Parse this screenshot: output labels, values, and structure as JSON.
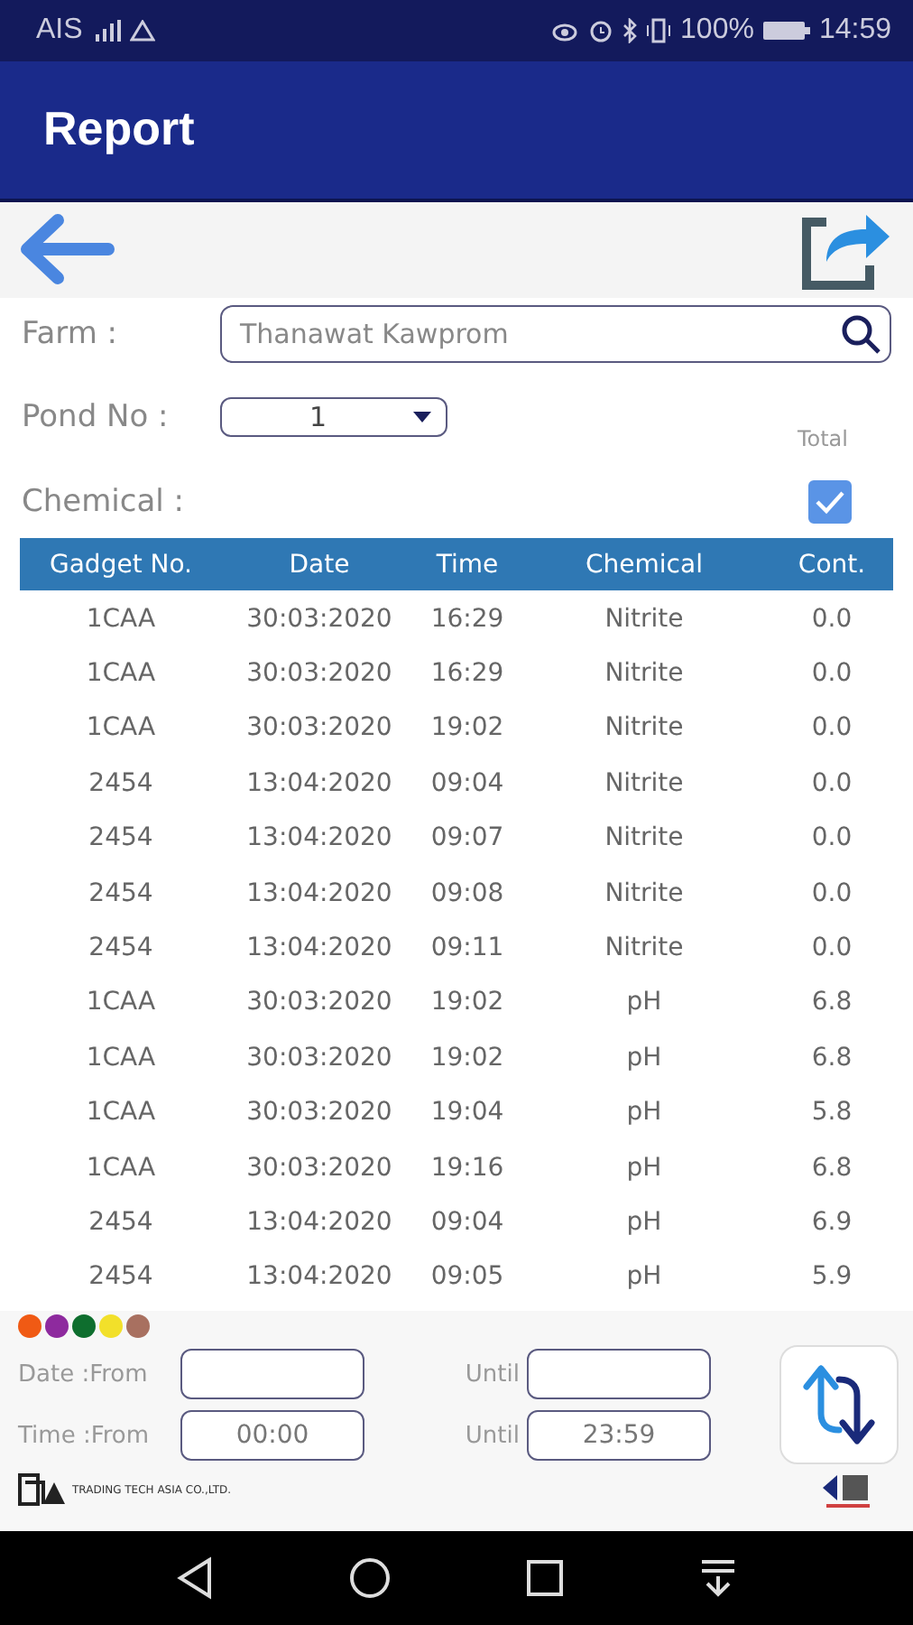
{
  "status_bar": {
    "carrier": "AIS",
    "battery": "100%",
    "time": "14:59"
  },
  "app_bar": {
    "title": "Report"
  },
  "form": {
    "farm_label": "Farm :",
    "farm_value": "Thanawat Kawprom",
    "pond_label": "Pond No :",
    "pond_value": "1",
    "total_label": "Total",
    "total_checked": true,
    "chemical_label": "Chemical :"
  },
  "table": {
    "columns": [
      "Gadget No.",
      "Date",
      "Time",
      "Chemical",
      "Cont."
    ],
    "rows": [
      [
        "1CAA",
        "30:03:2020",
        "16:29",
        "Nitrite",
        "0.0"
      ],
      [
        "1CAA",
        "30:03:2020",
        "16:29",
        "Nitrite",
        "0.0"
      ],
      [
        "1CAA",
        "30:03:2020",
        "19:02",
        "Nitrite",
        "0.0"
      ],
      [
        "2454",
        "13:04:2020",
        "09:04",
        "Nitrite",
        "0.0"
      ],
      [
        "2454",
        "13:04:2020",
        "09:07",
        "Nitrite",
        "0.0"
      ],
      [
        "2454",
        "13:04:2020",
        "09:08",
        "Nitrite",
        "0.0"
      ],
      [
        "2454",
        "13:04:2020",
        "09:11",
        "Nitrite",
        "0.0"
      ],
      [
        "1CAA",
        "30:03:2020",
        "19:02",
        "pH",
        "6.8"
      ],
      [
        "1CAA",
        "30:03:2020",
        "19:02",
        "pH",
        "6.8"
      ],
      [
        "1CAA",
        "30:03:2020",
        "19:04",
        "pH",
        "5.8"
      ],
      [
        "1CAA",
        "30:03:2020",
        "19:16",
        "pH",
        "6.8"
      ],
      [
        "2454",
        "13:04:2020",
        "09:04",
        "pH",
        "6.9"
      ],
      [
        "2454",
        "13:04:2020",
        "09:05",
        "pH",
        "5.9"
      ]
    ]
  },
  "legend_dots": [
    {
      "color": "#f05a14"
    },
    {
      "color": "#8e2a9e"
    },
    {
      "color": "#0e6e2e"
    },
    {
      "color": "#f2e02a"
    },
    {
      "color": "#a87060"
    }
  ],
  "date_filter": {
    "label": "Date :From",
    "until_label": "Until"
  },
  "time_filter": {
    "label": "Time :From",
    "from_value": "00:00",
    "until_label": "Until",
    "until_value": "23:59"
  },
  "footer": {
    "company": "TRADING TECH ASIA CO.,LTD."
  }
}
